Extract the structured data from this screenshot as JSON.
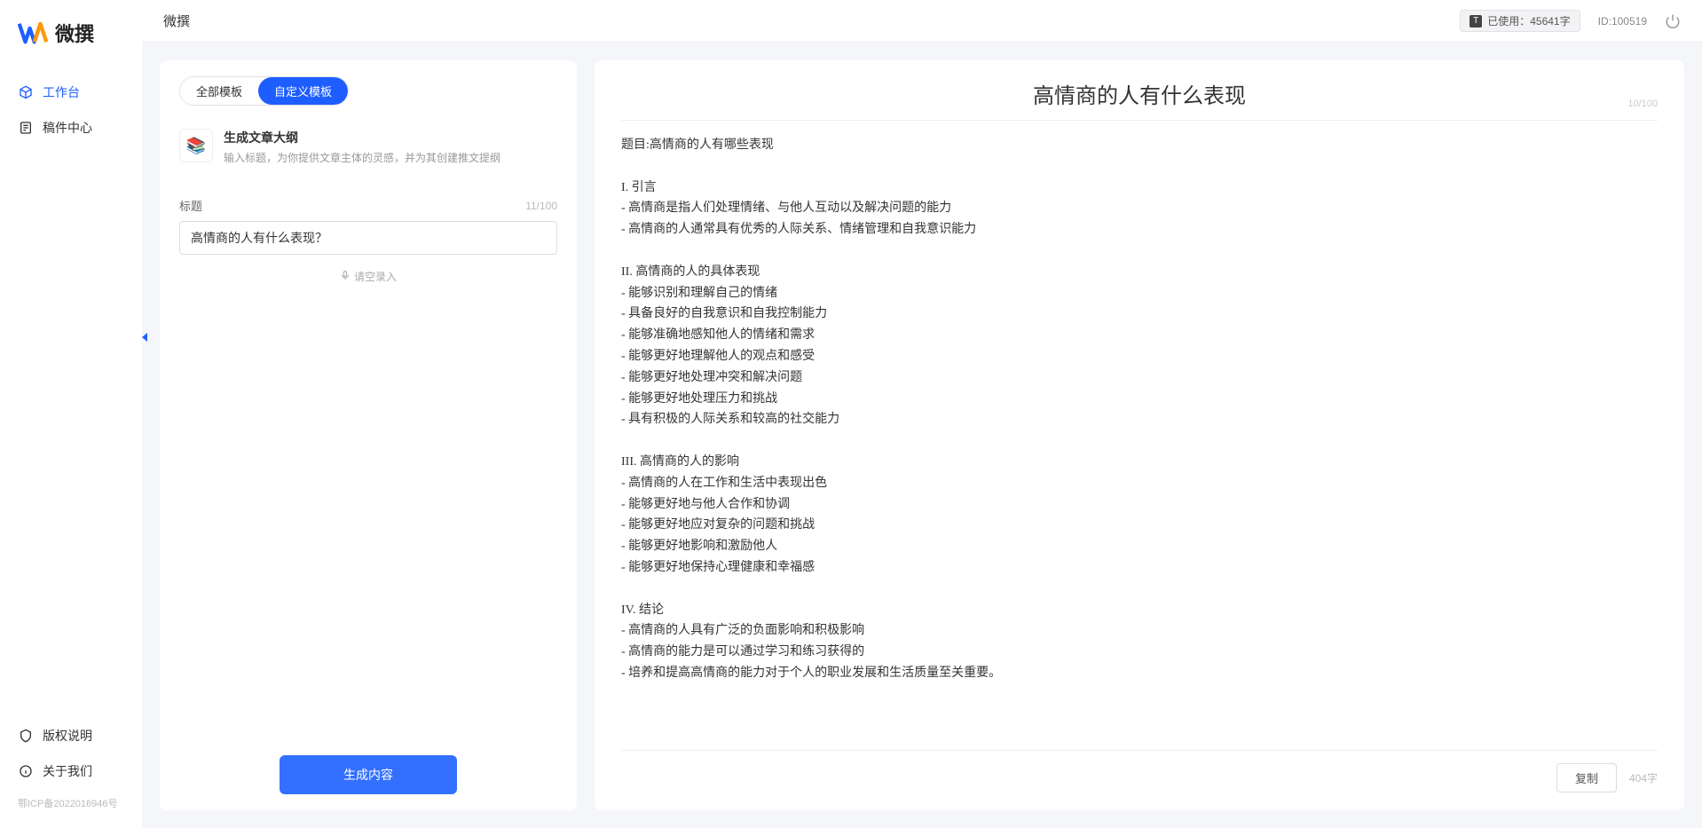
{
  "app": {
    "name": "微撰",
    "title": "微撰"
  },
  "sidebar": {
    "nav": [
      {
        "label": "工作台",
        "active": true
      },
      {
        "label": "稿件中心",
        "active": false
      }
    ],
    "bottom": [
      {
        "label": "版权说明"
      },
      {
        "label": "关于我们"
      }
    ],
    "icp": "鄂ICP备2022016946号"
  },
  "topbar": {
    "usage_prefix": "已使用：",
    "usage_value": "45641字",
    "id_label": "ID:100519"
  },
  "left": {
    "tabs": [
      {
        "label": "全部模板",
        "active": false
      },
      {
        "label": "自定义模板",
        "active": true
      }
    ],
    "template": {
      "icon": "📚",
      "title": "生成文章大纲",
      "desc": "输入标题，为你提供文章主体的灵感，并为其创建推文提纲"
    },
    "field_label": "标题",
    "field_count": "11/100",
    "title_value": "高情商的人有什么表现？",
    "voice_hint": "请空录入",
    "generate_label": "生成内容"
  },
  "output": {
    "title": "高情商的人有什么表现",
    "top_count": "10/100",
    "body": "题目:高情商的人有哪些表现\n\nI. 引言\n- 高情商是指人们处理情绪、与他人互动以及解决问题的能力\n- 高情商的人通常具有优秀的人际关系、情绪管理和自我意识能力\n\nII. 高情商的人的具体表现\n- 能够识别和理解自己的情绪\n- 具备良好的自我意识和自我控制能力\n- 能够准确地感知他人的情绪和需求\n- 能够更好地理解他人的观点和感受\n- 能够更好地处理冲突和解决问题\n- 能够更好地处理压力和挑战\n- 具有积极的人际关系和较高的社交能力\n\nIII. 高情商的人的影响\n- 高情商的人在工作和生活中表现出色\n- 能够更好地与他人合作和协调\n- 能够更好地应对复杂的问题和挑战\n- 能够更好地影响和激励他人\n- 能够更好地保持心理健康和幸福感\n\nIV. 结论\n- 高情商的人具有广泛的负面影响和积极影响\n- 高情商的能力是可以通过学习和练习获得的\n- 培养和提高高情商的能力对于个人的职业发展和生活质量至关重要。",
    "copy_label": "复制",
    "char_count": "404字"
  }
}
